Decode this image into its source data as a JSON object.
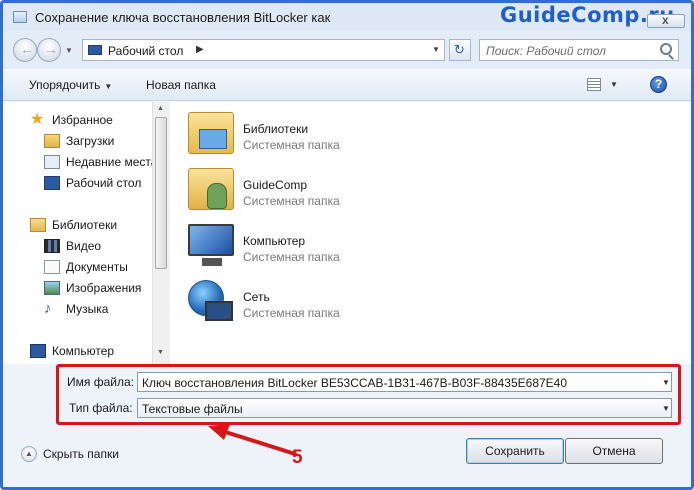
{
  "window": {
    "title": "Сохранение ключа восстановления BitLocker как",
    "watermark": "GuideComp.ru",
    "close_glyph": "x"
  },
  "address": {
    "location": "Рабочий стол",
    "search_placeholder": "Поиск: Рабочий стол"
  },
  "toolbar": {
    "organize_label": "Упорядочить",
    "new_folder_label": "Новая папка",
    "help_glyph": "?"
  },
  "sidebar": {
    "items": [
      {
        "label": "Избранное",
        "icon": "star-icon"
      },
      {
        "label": "Загрузки",
        "icon": "downloads-folder-icon"
      },
      {
        "label": "Недавние места",
        "icon": "recent-places-icon"
      },
      {
        "label": "Рабочий стол",
        "icon": "desktop-icon"
      },
      {
        "label": "Библиотеки",
        "icon": "libraries-icon"
      },
      {
        "label": "Видео",
        "icon": "video-icon"
      },
      {
        "label": "Документы",
        "icon": "documents-icon"
      },
      {
        "label": "Изображения",
        "icon": "pictures-icon"
      },
      {
        "label": "Музыка",
        "icon": "music-icon"
      },
      {
        "label": "Компьютер",
        "icon": "computer-icon"
      }
    ]
  },
  "files": [
    {
      "name": "Библиотеки",
      "type": "Системная папка",
      "icon": "libraries-folder-icon"
    },
    {
      "name": "GuideComp",
      "type": "Системная папка",
      "icon": "user-folder-icon"
    },
    {
      "name": "Компьютер",
      "type": "Системная папка",
      "icon": "computer-icon"
    },
    {
      "name": "Сеть",
      "type": "Системная папка",
      "icon": "network-icon"
    }
  ],
  "form": {
    "filename_label": "Имя файла:",
    "filename_value": "Ключ восстановления BitLocker BE53CCAB-1B31-467B-B03F-88435E687E40",
    "filetype_label": "Тип файла:",
    "filetype_value": "Текстовые файлы"
  },
  "annotation": {
    "step_number": "5",
    "color": "#d8161a"
  },
  "footer": {
    "hide_folders_label": "Скрыть папки",
    "save_label": "Сохранить",
    "cancel_label": "Отмена"
  },
  "colors": {
    "frame": "#2f6fd0",
    "watermark": "#1f5fc6",
    "highlight": "#d8161a"
  }
}
